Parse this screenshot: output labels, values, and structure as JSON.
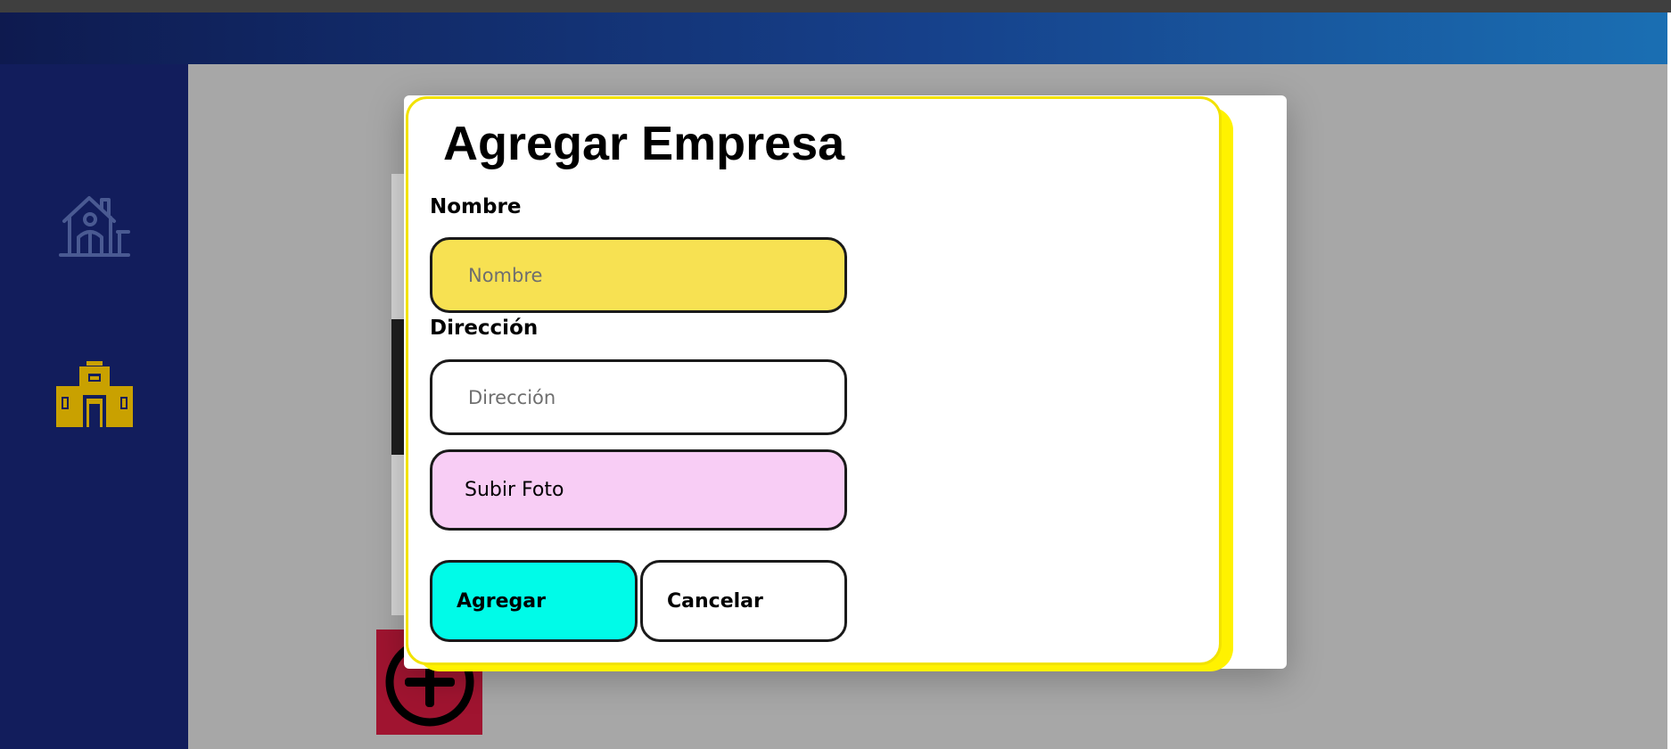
{
  "sidebar": {
    "items": [
      {
        "icon": "home-icon",
        "color": "#4a5a92"
      },
      {
        "icon": "company-building-icon",
        "color": "#c9a100"
      }
    ]
  },
  "fab": {
    "icon": "add-circle-icon",
    "color": "#a01430"
  },
  "modal": {
    "title": "Agregar Empresa",
    "fields": {
      "nombre": {
        "label": "Nombre",
        "placeholder": "Nombre",
        "value": ""
      },
      "direccion": {
        "label": "Dirección",
        "placeholder": "Dirección",
        "value": ""
      }
    },
    "upload_label": "Subir Foto",
    "add_label": "Agregar",
    "cancel_label": "Cancelar"
  },
  "colors": {
    "header_start": "#0e1a4f",
    "header_end": "#1a6fb3",
    "sidebar": "#121d5c",
    "modal_accent": "#fff200",
    "nombre_bg": "#f7e152",
    "upload_bg": "#f8cdf5",
    "add_bg": "#00fbe8"
  }
}
